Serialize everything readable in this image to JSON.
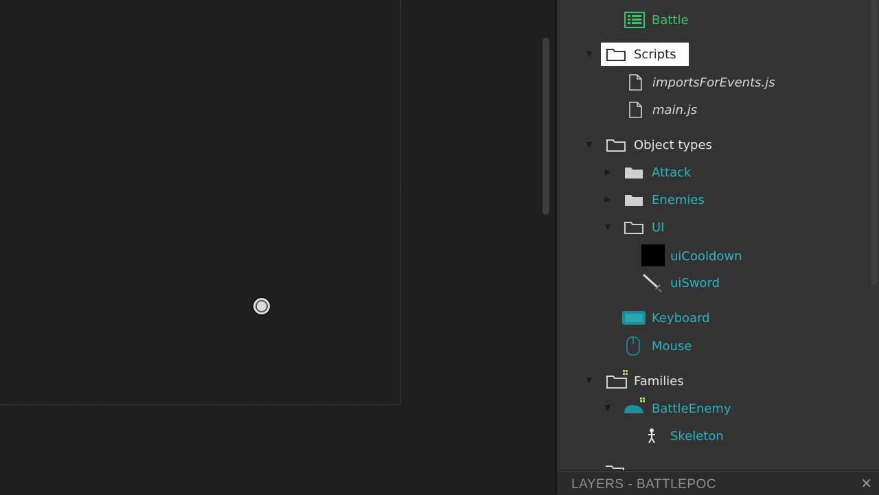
{
  "project_tree": {
    "battle": "Battle",
    "scripts": "Scripts",
    "imports_file": "importsForEvents.js",
    "main_file": "main.js",
    "object_types": "Object types",
    "attack": "Attack",
    "enemies": "Enemies",
    "ui": "UI",
    "ui_cooldown": "uiCooldown",
    "ui_sword": "uiSword",
    "keyboard": "Keyboard",
    "mouse": "Mouse",
    "families": "Families",
    "battle_enemy": "BattleEnemy",
    "skeleton": "Skeleton"
  },
  "layers_panel": {
    "title": "LAYERS - BATTLEPOC"
  },
  "colors": {
    "event_sheet_text": "#39c46e",
    "object_text": "#2bb3be",
    "selection_bg": "#ffffff"
  }
}
